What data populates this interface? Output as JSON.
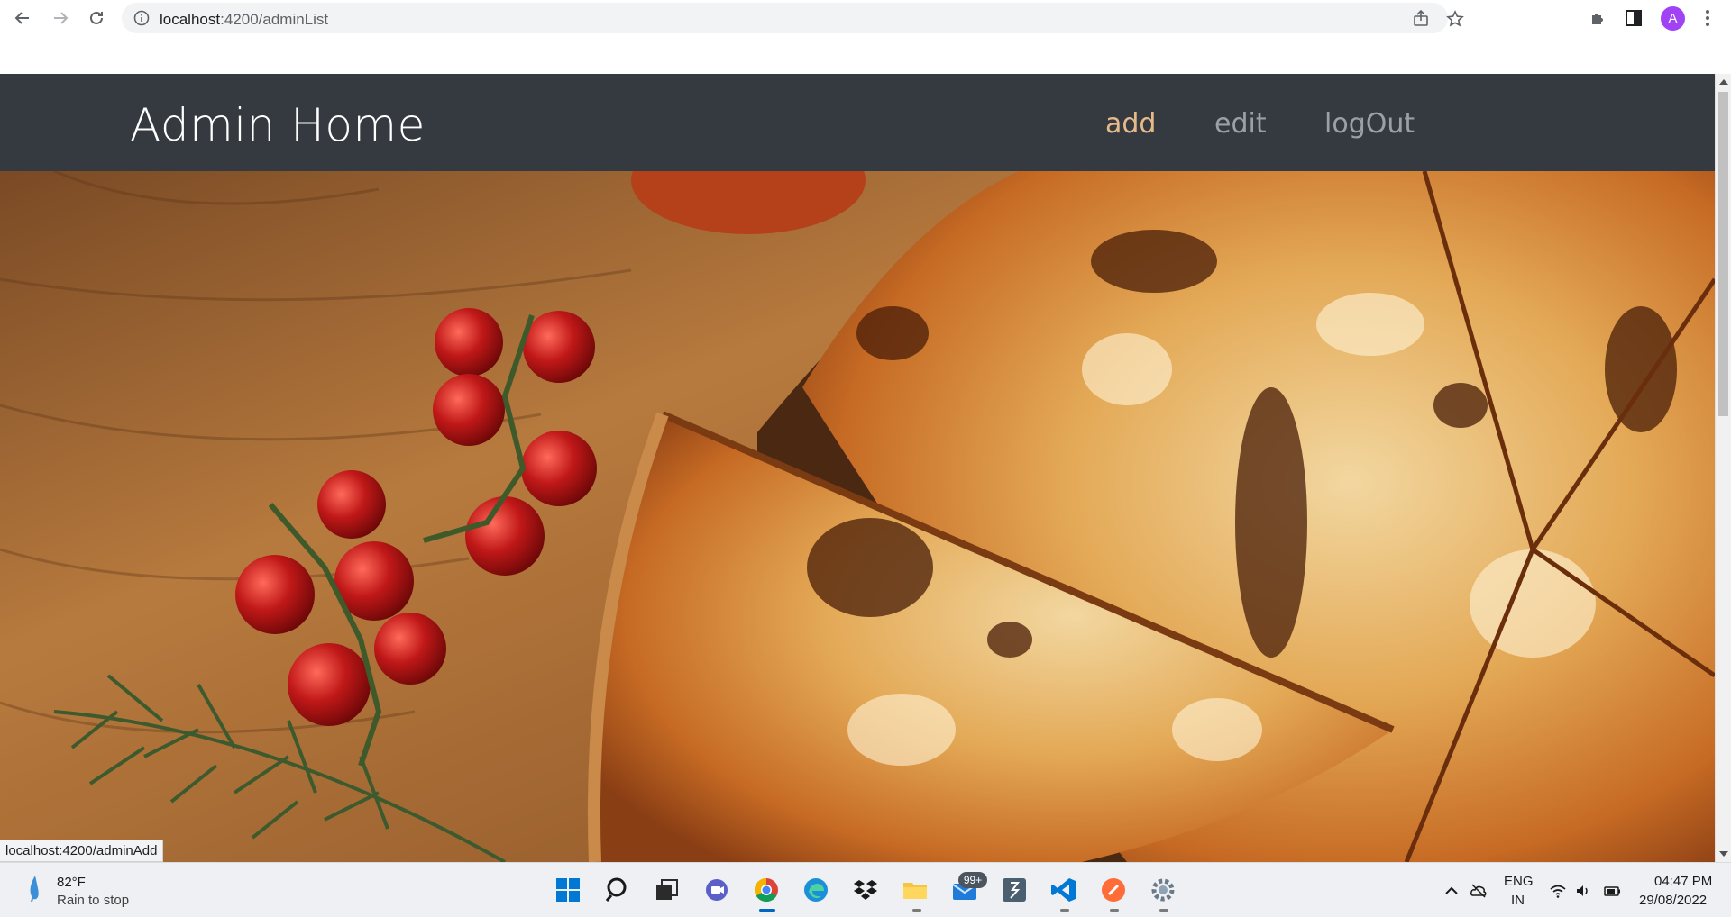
{
  "browser": {
    "url_host": "localhost",
    "url_path": ":4200/adminList",
    "profile_initial": "A"
  },
  "navbar": {
    "brand": "Admin Home",
    "links": [
      {
        "label": "add",
        "active": true
      },
      {
        "label": "edit",
        "active": false
      },
      {
        "label": "logOut",
        "active": false
      }
    ]
  },
  "hero": {
    "image": "pizza-on-wooden-board-with-cherry-tomatoes-and-rosemary"
  },
  "status_bar": {
    "hover_url": "localhost:4200/adminAdd"
  },
  "taskbar": {
    "weather": {
      "temp": "82°F",
      "desc": "Rain to stop"
    },
    "apps": [
      "start-icon",
      "search-icon",
      "task-view-icon",
      "teams-chat-icon",
      "chrome-icon",
      "edge-icon",
      "dropbox-icon",
      "file-explorer-icon",
      "mail-icon",
      "terminal-app-icon",
      "vscode-icon",
      "postman-icon",
      "settings-icon"
    ],
    "mail_badge": "99+",
    "language": {
      "line1": "ENG",
      "line2": "IN"
    },
    "clock": {
      "time": "04:47 PM",
      "date": "29/08/2022"
    }
  },
  "colors": {
    "navbar_bg": "#343a40",
    "nav_active": "#e5b98a",
    "nav_inactive": "#9aa0a6",
    "accent": "#0067c0"
  }
}
